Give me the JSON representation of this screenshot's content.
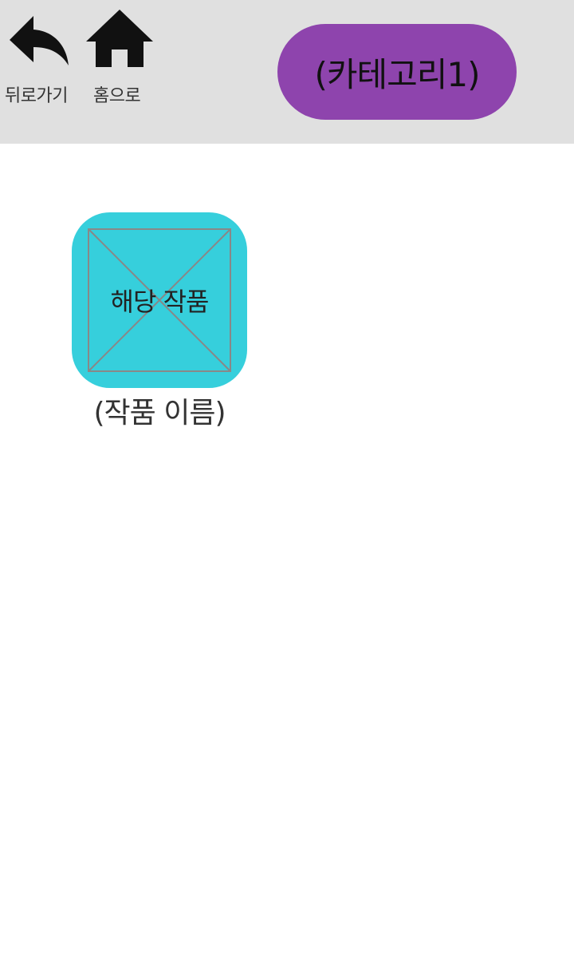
{
  "header": {
    "back": {
      "label": "뒤로가기",
      "icon": "back-arrow-icon"
    },
    "home": {
      "label": "홈으로",
      "icon": "home-icon"
    },
    "category": {
      "label": "(카테고리1)",
      "color": "#8e44ad"
    }
  },
  "items": [
    {
      "thumb_label": "해당 작품",
      "name": "(작품 이름)",
      "color": "#36cfdc",
      "image": "placeholder-image-icon"
    }
  ],
  "colors": {
    "header_bg": "#e0e0e0",
    "page_bg": "#ffffff"
  }
}
